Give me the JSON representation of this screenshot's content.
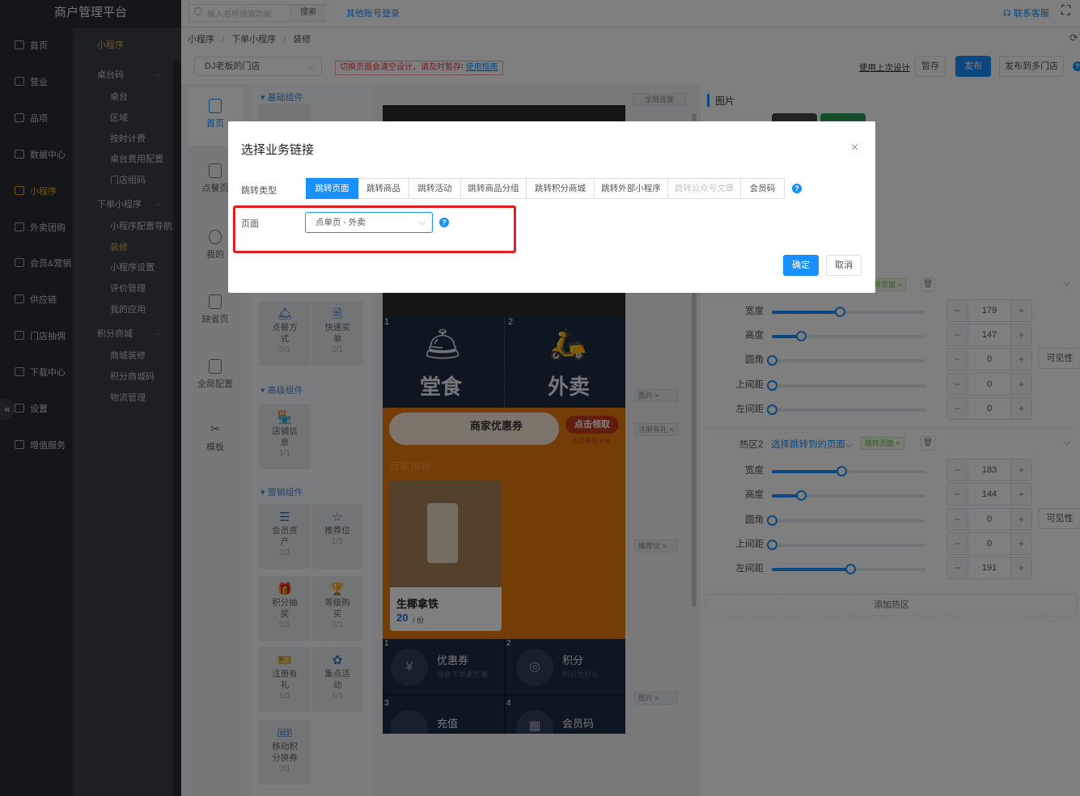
{
  "brand": "商户管理平台",
  "main_nav": [
    {
      "label": "首页",
      "active": false
    },
    {
      "label": "营业",
      "active": false
    },
    {
      "label": "品项",
      "active": false
    },
    {
      "label": "数据中心",
      "active": false
    },
    {
      "label": "小程序",
      "active": true
    },
    {
      "label": "外卖团购",
      "active": false
    },
    {
      "label": "会员&营销",
      "active": false
    },
    {
      "label": "供应链",
      "active": false
    },
    {
      "label": "门店抽佣",
      "active": false
    },
    {
      "label": "下载中心",
      "active": false
    },
    {
      "label": "设置",
      "active": false
    },
    {
      "label": "增值服务",
      "active": false
    }
  ],
  "sub_nav": {
    "title": "小程序",
    "groups": [
      {
        "label": "桌台码",
        "items": [
          "桌台",
          "区域",
          "按时计费",
          "桌台费用配置",
          "门店组码"
        ]
      },
      {
        "label": "下单小程序",
        "items": [
          "小程序配置导航",
          "装修",
          "小程序设置",
          "评价管理",
          "我的应用"
        ]
      },
      {
        "label": "积分商城",
        "items": [
          "商城装修",
          "积分商城码",
          "物流管理"
        ]
      }
    ],
    "active_item": "装修"
  },
  "header": {
    "search_placeholder": "输入名称搜索功能",
    "search_button": "搜索",
    "other_login": "其他账号登录",
    "contact": "联系客服"
  },
  "breadcrumb": [
    "小程序",
    "下单小程序",
    "装修"
  ],
  "toolbar": {
    "store": "DJ老板的门店",
    "warning": "切换页面会清空设计，请及时暂存!",
    "guide": "使用指南",
    "use_last": "使用上次设计",
    "save_draft": "暂存",
    "publish": "发布",
    "publish_multi": "发布到多门店"
  },
  "pages": [
    "首页",
    "点餐页",
    "我的",
    "缺省页",
    "全局配置",
    "模板"
  ],
  "component_sections": {
    "basic": "基础组件",
    "advanced": "高级组件",
    "marketing": "营销组件"
  },
  "components": [
    {
      "name": "点餐方式",
      "count": "0/1"
    },
    {
      "name": "快速买单",
      "count": "0/1"
    },
    {
      "name": "店铺信息",
      "count": "1/1"
    },
    {
      "name": "会员资产",
      "count": "0/1"
    },
    {
      "name": "推荐位",
      "count": "1/5"
    },
    {
      "name": "积分抽奖",
      "count": "0/1"
    },
    {
      "name": "等级购买",
      "count": "0/1"
    },
    {
      "name": "注册有礼",
      "count": "1/1"
    },
    {
      "name": "集点活动",
      "count": "1/1"
    },
    {
      "name": "移动积分换券",
      "count": "0/1"
    }
  ],
  "global_settings": "全局设置",
  "phone": {
    "tile1_num": "1",
    "tile1_label": "堂食",
    "tile2_num": "2",
    "tile2_label": "外卖",
    "coupon_title": "商家优惠券",
    "coupon_btn": "点击领取",
    "coupon_sub": "先领券再下单",
    "rec_title": "商家推荐",
    "product_name": "生椰拿铁",
    "product_price": "20",
    "product_unit": "/ 份",
    "g1_num": "1",
    "g1_title": "优惠券",
    "g1_sub": "领券下单更优惠",
    "g2_num": "2",
    "g2_title": "积分",
    "g2_sub": "积分兑好礼",
    "g3_num": "3",
    "g3_title": "充值",
    "g4_num": "4",
    "g4_title": "会员码"
  },
  "side_tags": [
    "图片",
    "注册有礼",
    "推荐位",
    "图片"
  ],
  "right_panel": {
    "title": "图片",
    "hot1_tag": "跳转页面",
    "hot2_label": "热区2",
    "hot2_link": "选择跳转到的页面",
    "hot2_tag": "跳转页面",
    "visible_btn": "可见性",
    "add_hotspot": "添加热区",
    "hot1": [
      {
        "label": "宽度",
        "value": "179",
        "pct": 0.44
      },
      {
        "label": "高度",
        "value": "147",
        "pct": 0.19
      },
      {
        "label": "圆角",
        "value": "0",
        "pct": 0
      },
      {
        "label": "上间距",
        "value": "0",
        "pct": 0
      },
      {
        "label": "左间距",
        "value": "0",
        "pct": 0
      }
    ],
    "hot2": [
      {
        "label": "宽度",
        "value": "183",
        "pct": 0.45
      },
      {
        "label": "高度",
        "value": "144",
        "pct": 0.19
      },
      {
        "label": "圆角",
        "value": "0",
        "pct": 0
      },
      {
        "label": "上间距",
        "value": "0",
        "pct": 0
      },
      {
        "label": "左间距",
        "value": "191",
        "pct": 0.51
      }
    ]
  },
  "modal": {
    "title": "选择业务链接",
    "jump_type_label": "跳转类型",
    "tabs": [
      {
        "label": "跳转页面",
        "state": "active"
      },
      {
        "label": "跳转商品",
        "state": "normal"
      },
      {
        "label": "跳转活动",
        "state": "normal"
      },
      {
        "label": "跳转商品分组",
        "state": "normal"
      },
      {
        "label": "跳转积分商城",
        "state": "normal"
      },
      {
        "label": "跳转外部小程序",
        "state": "normal"
      },
      {
        "label": "跳转公众号文章",
        "state": "disabled"
      },
      {
        "label": "会员码",
        "state": "normal"
      }
    ],
    "page_label": "页面",
    "page_value": "点单页 - 外卖",
    "confirm": "确定",
    "cancel": "取消"
  },
  "colors": {
    "accent": "#1890ff",
    "sidebar": "#2a2d33",
    "active_nav": "#e5a535",
    "highlight": "#e02020",
    "phone_orange": "#e87a10"
  }
}
